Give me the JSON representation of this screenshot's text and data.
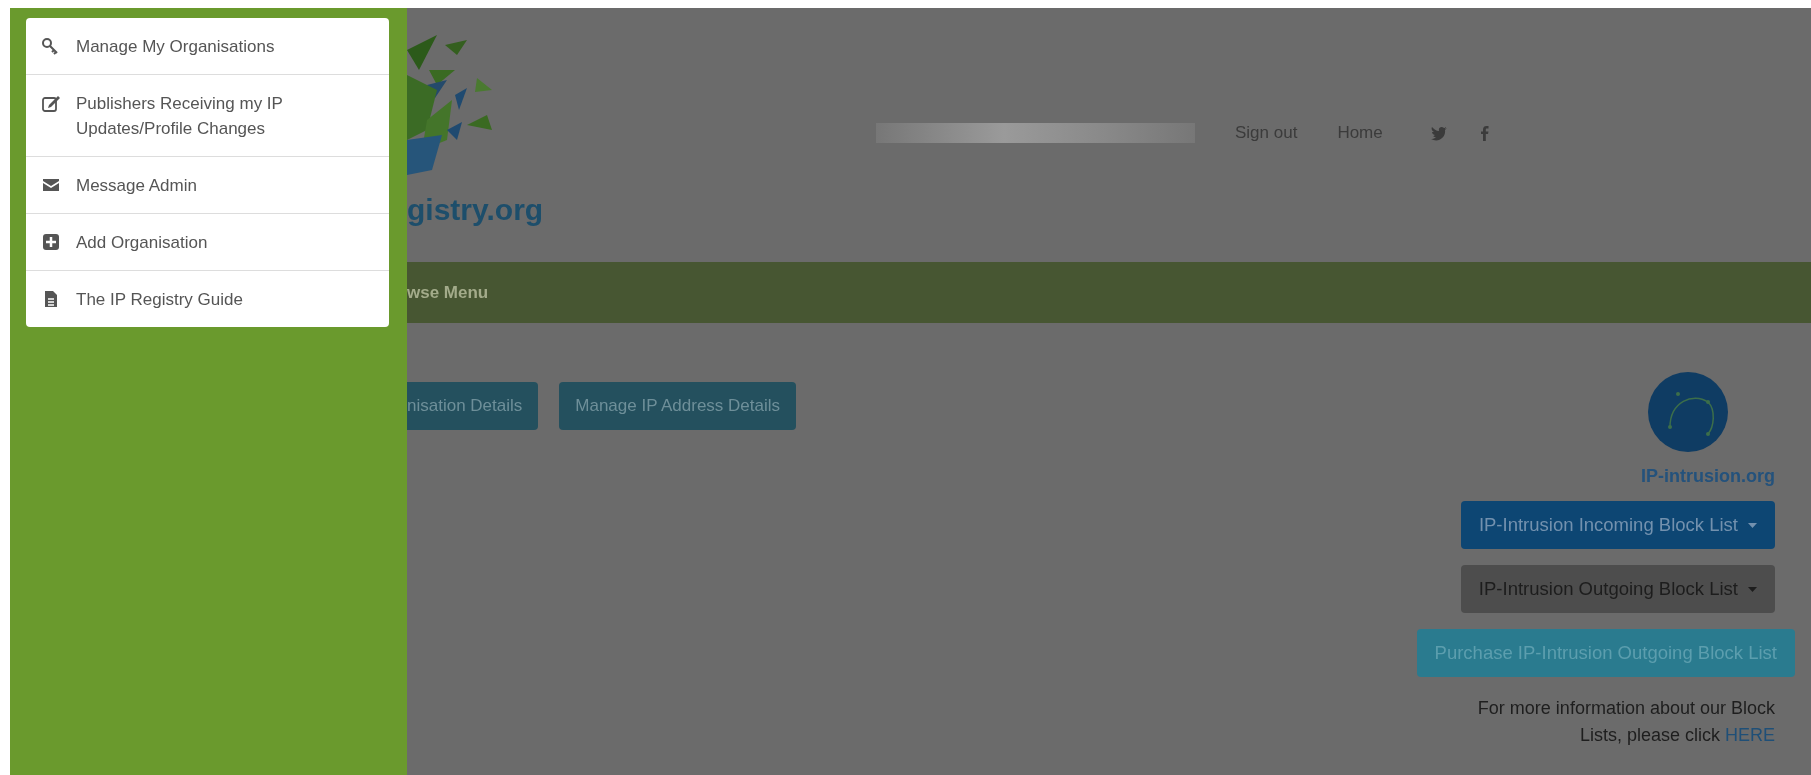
{
  "side_menu": {
    "items": [
      {
        "label": "Manage My Organisations"
      },
      {
        "label": "Publishers Receiving my IP Updates/Profile Changes"
      },
      {
        "label": "Message Admin"
      },
      {
        "label": "Add Organisation"
      },
      {
        "label": "The IP Registry Guide"
      }
    ]
  },
  "header": {
    "logo_text": "gistry.org",
    "nav_links": [
      "Sign out",
      "Home"
    ]
  },
  "nav_bar": {
    "label": "wse Menu"
  },
  "actions": [
    "nisation Details",
    "Manage IP Address Details"
  ],
  "block_lists": {
    "logo_text": "IP-intrusion.org",
    "buttons": [
      {
        "label": "IP-Intrusion Incoming Block List",
        "kind": "primary",
        "dropdown": true
      },
      {
        "label": "IP-Intrusion Outgoing Block List",
        "kind": "dark",
        "dropdown": true
      },
      {
        "label": "Purchase IP-Intrusion Outgoing Block List",
        "kind": "info",
        "dropdown": false
      }
    ],
    "info": {
      "text": "For more information about our Block Lists, please click",
      "link": "HERE"
    }
  }
}
